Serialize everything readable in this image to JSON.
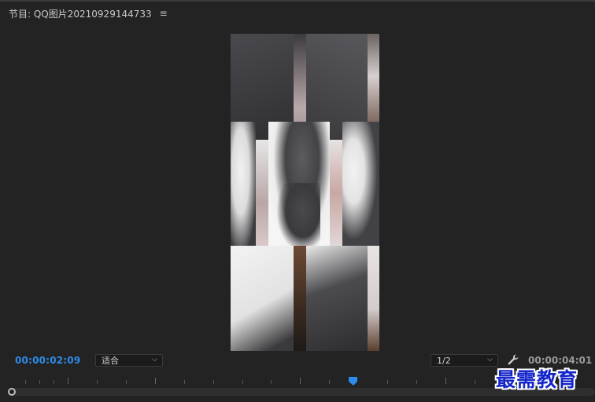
{
  "panel": {
    "title": "节目: QQ图片20210929144733",
    "menu_icon": "hamburger-menu-icon"
  },
  "controls": {
    "current_timecode": "00:00:02:09",
    "fit_value": "适合",
    "resolution_value": "1/2",
    "duration_timecode": "00:00:04:01",
    "settings_icon": "wrench-icon"
  },
  "watermark": {
    "text": "最需教育"
  },
  "colors": {
    "accent": "#2d8ceb",
    "background": "#232323",
    "watermark": "#1426c8"
  }
}
